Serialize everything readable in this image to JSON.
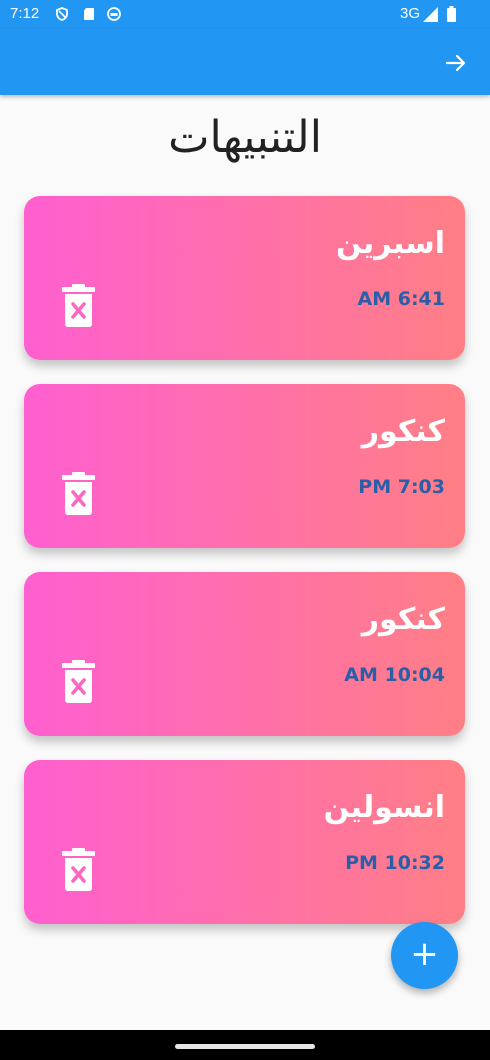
{
  "status_bar": {
    "time": "7:12",
    "network": "3G",
    "icons": [
      "shield-icon",
      "sd-card-icon",
      "record-icon",
      "signal-icon",
      "battery-icon"
    ]
  },
  "app_bar": {
    "icon": "arrow-right-icon",
    "color": "#2196f3"
  },
  "page": {
    "title": "التنبيهات"
  },
  "alarms": [
    {
      "name": "اسبرين",
      "time": "AM 6:41"
    },
    {
      "name": "كنكور",
      "time": "PM 7:03"
    },
    {
      "name": "كنكور",
      "time": "AM 10:04"
    },
    {
      "name": "انسولين",
      "time": "PM 10:32"
    }
  ],
  "card_colors": {
    "gradient_start": "#ff5fd0",
    "gradient_end": "#ff7f85",
    "time_color": "#2a5fa8"
  },
  "fab": {
    "label": "+",
    "icon": "add-icon",
    "color": "#2196f3"
  }
}
